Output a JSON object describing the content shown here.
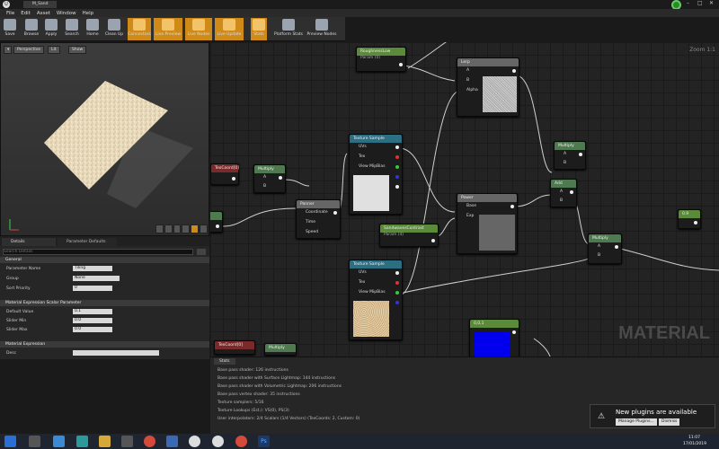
{
  "menu": [
    "File",
    "Edit",
    "Asset",
    "Window",
    "Help"
  ],
  "window_title": "M_Sand",
  "toolbar": [
    {
      "label": "Save",
      "icon": "save-icon",
      "active": false
    },
    {
      "label": "Browse",
      "icon": "browse-icon",
      "active": false
    },
    {
      "label": "Apply",
      "icon": "apply-icon",
      "active": false
    },
    {
      "label": "Search",
      "icon": "search-icon",
      "active": false
    },
    {
      "label": "Home",
      "icon": "home-icon",
      "active": false
    },
    {
      "label": "Clean Up",
      "icon": "cleanup-icon",
      "active": false
    },
    {
      "label": "Connectors",
      "icon": "connectors-icon",
      "active": true
    },
    {
      "label": "Live Preview",
      "icon": "live-preview-icon",
      "active": true
    },
    {
      "label": "Live Nodes",
      "icon": "live-nodes-icon",
      "active": true
    },
    {
      "label": "Live Update",
      "icon": "live-update-icon",
      "active": true
    },
    {
      "label": "Stats",
      "icon": "stats-icon",
      "active": true
    },
    {
      "label": "Platform Stats",
      "icon": "platform-stats-icon",
      "active": false
    },
    {
      "label": "Preview Nodes",
      "icon": "preview-nodes-icon",
      "active": false
    }
  ],
  "viewport": {
    "perspective": "Perspective",
    "lit": "Lit",
    "show": "Show"
  },
  "tabs": {
    "details": "Details",
    "param_defaults": "Parameter Defaults"
  },
  "search_placeholder": "Search Details",
  "details": {
    "general": "General",
    "param_name_label": "Parameter Name",
    "param_name": "Tiling",
    "group_label": "Group",
    "group": "None",
    "sort_label": "Sort Priority",
    "sort": "0",
    "scalar_section": "Material Expression Scalar Parameter",
    "default_label": "Default Value",
    "default": "0.1",
    "min_label": "Slider Min",
    "min": "0.0",
    "max_label": "Slider Max",
    "max": "0.0",
    "expr_section": "Material Expression",
    "desc_label": "Desc"
  },
  "graph": {
    "zoom": "Zoom 1:1",
    "watermark": "MATERIAL",
    "nodes": {
      "roughness": {
        "title": "RoughnessLow",
        "sub": "Param (0)"
      },
      "lerp": {
        "title": "Lerp",
        "pins": [
          "A",
          "B",
          "Alpha"
        ]
      },
      "texcoord1": {
        "title": "TexCoord[0]"
      },
      "multiply1": {
        "title": "Multiply",
        "pins": [
          "A",
          "B"
        ]
      },
      "panner": {
        "title": "Panner",
        "pins": [
          "Coordinate",
          "Time",
          "Speed"
        ]
      },
      "tex1": {
        "title": "Texture Sample",
        "pins": [
          "UVs",
          "Tex",
          "View MipBias"
        ]
      },
      "multiply2": {
        "title": "Multiply",
        "pins": [
          "A",
          "B"
        ]
      },
      "add": {
        "title": "Add",
        "pins": [
          "A",
          "B"
        ]
      },
      "power": {
        "title": "Power",
        "pins": [
          "Base",
          "Exp"
        ]
      },
      "contrast": {
        "title": "SandwavesContrast",
        "sub": "Param (4)"
      },
      "multiply3": {
        "title": "Multiply",
        "pins": [
          "A",
          "B"
        ]
      },
      "const09": {
        "title": "0.9"
      },
      "tex2": {
        "title": "Texture Sample",
        "pins": [
          "UVs",
          "Tex",
          "View MipBias"
        ]
      },
      "const3": {
        "title": "0,0,1"
      },
      "texcoord2": {
        "title": "TexCoord[0]"
      },
      "multiply4": {
        "title": "Multiply"
      }
    }
  },
  "stats": {
    "tab": "Stats",
    "lines": [
      "Base pass shader: 126 instructions",
      "Base pass shader with Surface Lightmap: 144 instructions",
      "Base pass shader with Volumetric Lightmap: 206 instructions",
      "Base pass vertex shader: 35 instructions",
      "Texture samplers: 5/16",
      "Texture Lookups (Est.): VS(0), PS(3)",
      "User interpolators: 2/4 Scalars (1/4 Vectors) (TexCoords: 2, Custom: 0)"
    ]
  },
  "notification": {
    "title": "New plugins are available",
    "manage": "Manage Plugins...",
    "dismiss": "Dismiss"
  },
  "taskbar": {
    "time": "11:07",
    "date": "17/01/2019"
  },
  "colors": {
    "accent": "#d08a18",
    "node_teal": "#2c6f83",
    "node_green": "#4f7a4f"
  }
}
